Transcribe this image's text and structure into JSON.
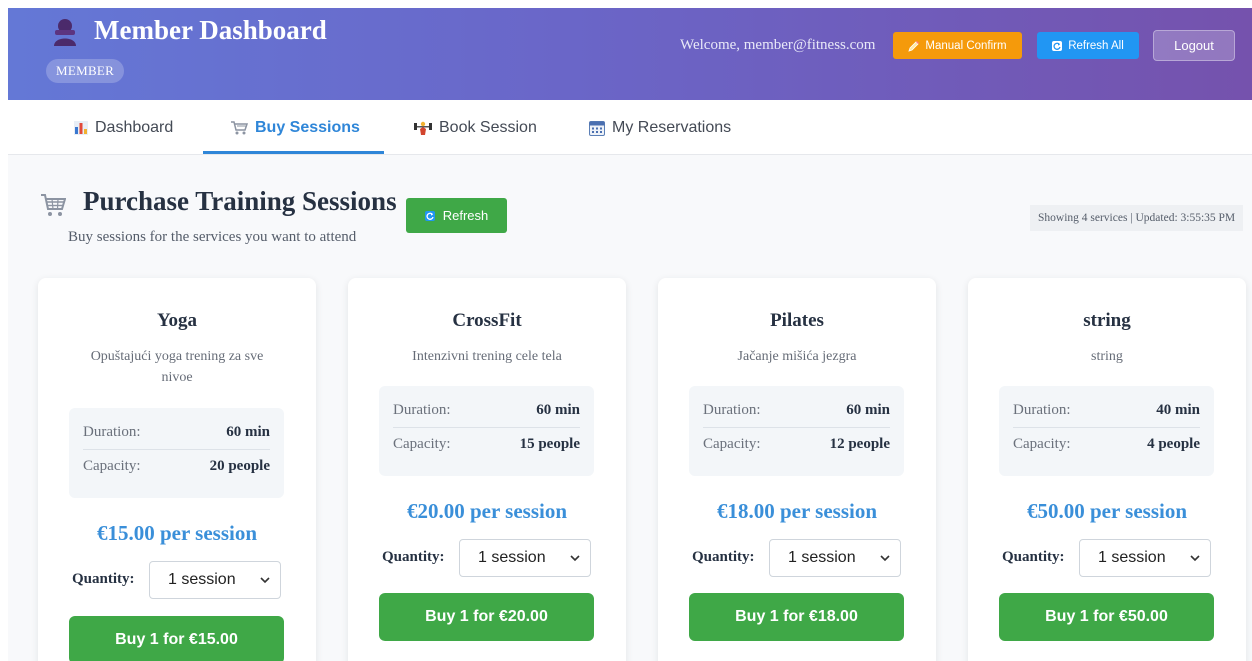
{
  "header": {
    "title": "Member Dashboard",
    "role_badge": "MEMBER",
    "welcome": "Welcome, member@fitness.com",
    "manual_confirm_label": "Manual Confirm",
    "refresh_all_label": "Refresh All",
    "logout_label": "Logout",
    "user_icon": "user-silhouette-icon",
    "colors": {
      "gradient_start": "#6478d6",
      "gradient_end": "#7552ad",
      "manual_confirm": "#f59a0b",
      "refresh_all": "#2196f3"
    }
  },
  "tabs": [
    {
      "label": "Dashboard",
      "icon": "bar-chart-icon",
      "active": false
    },
    {
      "label": "Buy Sessions",
      "icon": "shopping-cart-icon",
      "active": true
    },
    {
      "label": "Book Session",
      "icon": "weightlifter-icon",
      "active": false
    },
    {
      "label": "My Reservations",
      "icon": "calendar-icon",
      "active": false
    }
  ],
  "section": {
    "title": "Purchase Training Sessions",
    "subtitle": "Buy sessions for the services you want to attend",
    "refresh_label": "Refresh",
    "status": "Showing 4 services | Updated: 3:55:35 PM"
  },
  "labels": {
    "duration": "Duration:",
    "capacity": "Capacity:",
    "quantity": "Quantity:"
  },
  "services": [
    {
      "name": "Yoga",
      "description": "Opuštajući yoga trening za sve nivoe",
      "duration": "60 min",
      "capacity": "20 people",
      "price": "€15.00 per session",
      "quantity": "1 session",
      "buy_label": "Buy 1 for €15.00"
    },
    {
      "name": "CrossFit",
      "description": "Intenzivni trening cele tela",
      "duration": "60 min",
      "capacity": "15 people",
      "price": "€20.00 per session",
      "quantity": "1 session",
      "buy_label": "Buy 1 for €20.00"
    },
    {
      "name": "Pilates",
      "description": "Jačanje mišića jezgra",
      "duration": "60 min",
      "capacity": "12 people",
      "price": "€18.00 per session",
      "quantity": "1 session",
      "buy_label": "Buy 1 for €18.00"
    },
    {
      "name": "string",
      "description": "string",
      "duration": "40 min",
      "capacity": "4 people",
      "price": "€50.00 per session",
      "quantity": "1 session",
      "buy_label": "Buy 1 for €50.00"
    }
  ],
  "colors": {
    "accent_blue": "#2f86d8",
    "price_blue": "#3a8fd9",
    "buy_green": "#3fa847"
  }
}
